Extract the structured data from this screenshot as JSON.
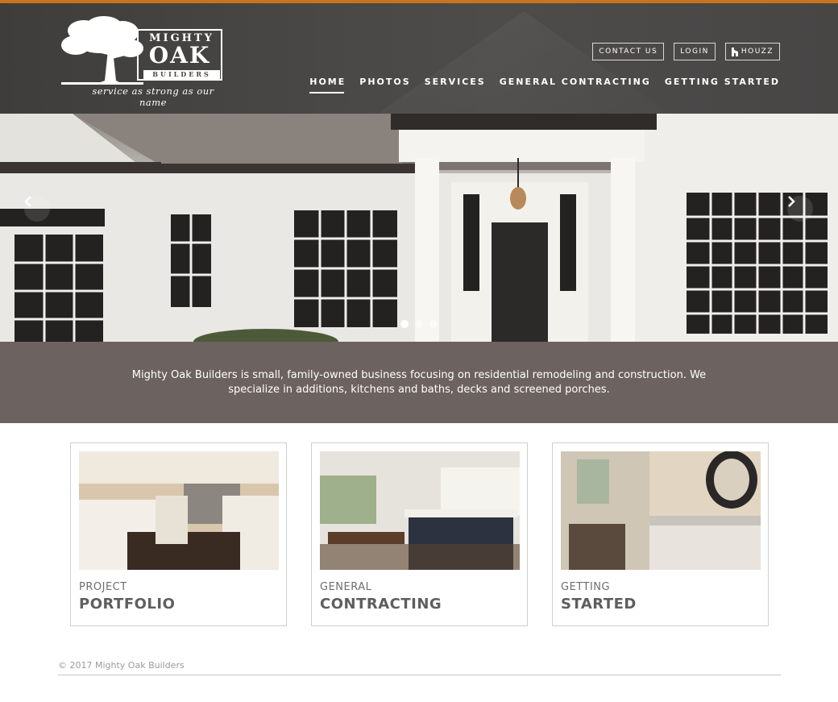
{
  "brand": {
    "word1": "MIGHTY",
    "word2": "OAK",
    "word3": "BUILDERS",
    "tagline": "service as strong as our name",
    "accent_color": "#c8741d"
  },
  "top_links": {
    "contact": "CONTACT US",
    "login": "LOGIN",
    "houzz": "HOUZZ"
  },
  "nav": {
    "items": [
      {
        "label": "HOME",
        "active": true
      },
      {
        "label": "PHOTOS"
      },
      {
        "label": "SERVICES"
      },
      {
        "label": "GENERAL CONTRACTING"
      },
      {
        "label": "GETTING STARTED"
      }
    ]
  },
  "carousel": {
    "prev_icon": "chevron-left-icon",
    "next_icon": "chevron-right-icon",
    "slide_count": 3,
    "active_slide": 1
  },
  "intro": {
    "text": "Mighty Oak Builders is small, family-owned business focusing on residential remodeling and construction. We specialize in additions, kitchens and baths, decks and screened porches."
  },
  "cards": [
    {
      "small": "PROJECT",
      "large": "PORTFOLIO"
    },
    {
      "small": "GENERAL",
      "large": "CONTRACTING"
    },
    {
      "small": "GETTING",
      "large": "STARTED"
    }
  ],
  "footer": {
    "copyright": "© 2017 Mighty Oak Builders"
  }
}
